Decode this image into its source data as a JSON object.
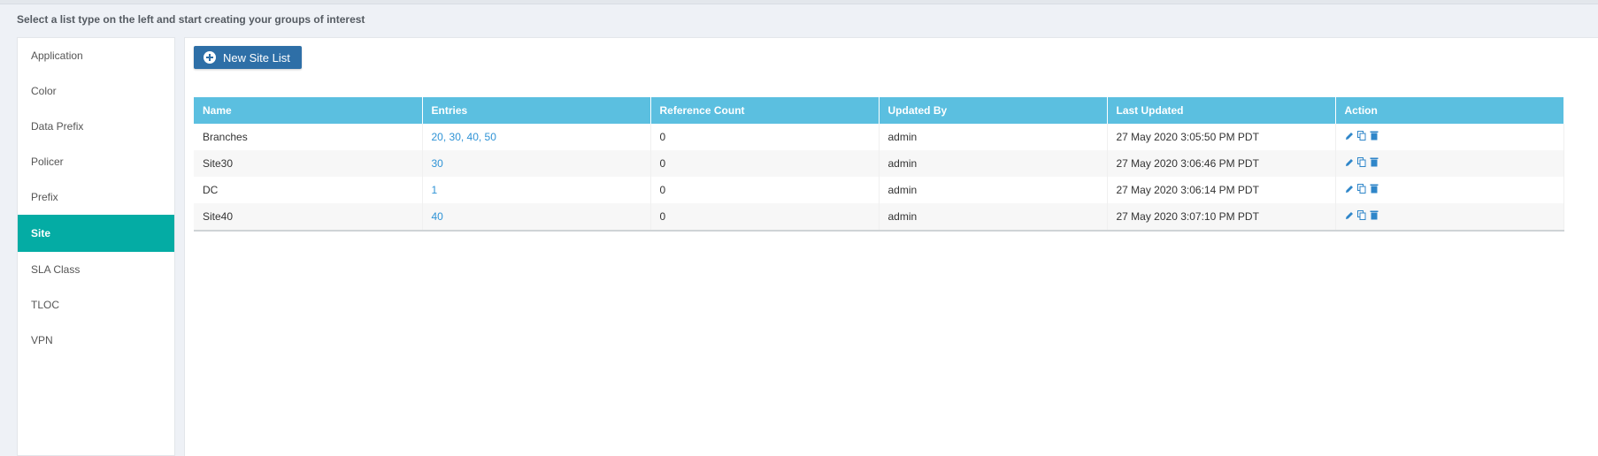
{
  "instruction": "Select a list type on the left and start creating your groups of interest",
  "sidebar": {
    "items": [
      {
        "label": "Application"
      },
      {
        "label": "Color"
      },
      {
        "label": "Data Prefix"
      },
      {
        "label": "Policer"
      },
      {
        "label": "Prefix"
      },
      {
        "label": "Site"
      },
      {
        "label": "SLA Class"
      },
      {
        "label": "TLOC"
      },
      {
        "label": "VPN"
      }
    ],
    "active": "Site"
  },
  "toolbar": {
    "new_label": "New Site List"
  },
  "table": {
    "headers": [
      "Name",
      "Entries",
      "Reference Count",
      "Updated By",
      "Last Updated",
      "Action"
    ],
    "rows": [
      {
        "name": "Branches",
        "entries": "20, 30, 40, 50",
        "ref_count": "0",
        "updated_by": "admin",
        "last_updated": "27 May 2020 3:05:50 PM PDT"
      },
      {
        "name": "Site30",
        "entries": "30",
        "ref_count": "0",
        "updated_by": "admin",
        "last_updated": "27 May 2020 3:06:46 PM PDT"
      },
      {
        "name": "DC",
        "entries": "1",
        "ref_count": "0",
        "updated_by": "admin",
        "last_updated": "27 May 2020 3:06:14 PM PDT"
      },
      {
        "name": "Site40",
        "entries": "40",
        "ref_count": "0",
        "updated_by": "admin",
        "last_updated": "27 May 2020 3:07:10 PM PDT"
      }
    ]
  },
  "colors": {
    "accent": "#04aca4",
    "header": "#5bbfe0",
    "button": "#2e6fa7",
    "link": "#2f93d6"
  },
  "icons": [
    "plus-circle-icon",
    "pencil-icon",
    "copy-icon",
    "trash-icon"
  ]
}
